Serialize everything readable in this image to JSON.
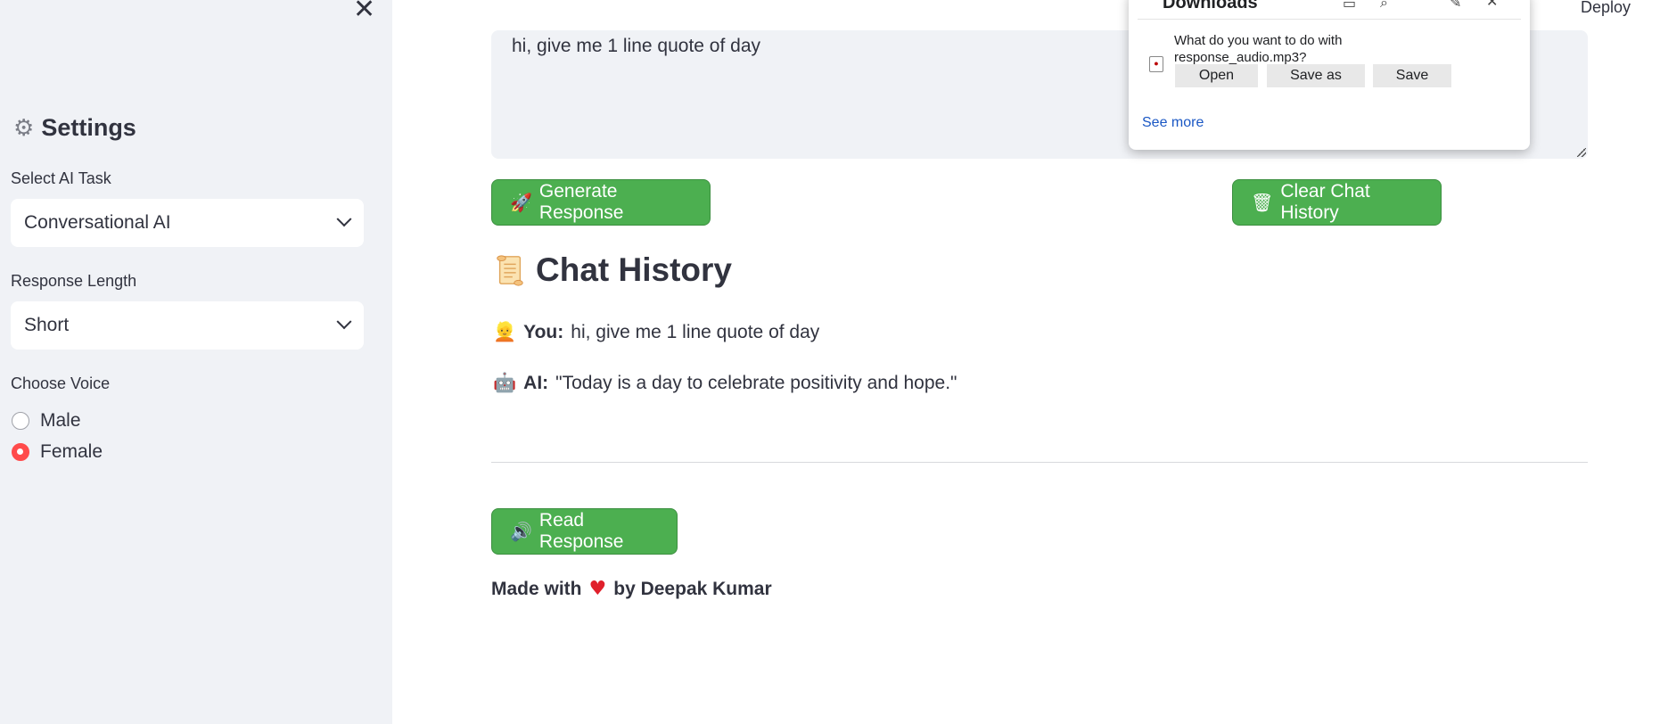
{
  "sidebar": {
    "close_glyph": "✕",
    "settings_icon": "gear-icon",
    "settings_title": "Settings",
    "task_label": "Select AI Task",
    "task_value": "Conversational AI",
    "length_label": "Response Length",
    "length_value": "Short",
    "voice_label": "Choose Voice",
    "voice_options": [
      {
        "label": "Male",
        "selected": false
      },
      {
        "label": "Female",
        "selected": true
      }
    ]
  },
  "main": {
    "prompt_text": "hi, give me 1 line quote of day",
    "generate_label": "Generate Response",
    "generate_icon": "🚀",
    "clear_label": "Clear Chat History",
    "clear_icon": "🗑",
    "chat_title": "Chat History",
    "chat": [
      {
        "speaker": "You:",
        "icon": "👱",
        "text": "hi, give me 1 line quote of day"
      },
      {
        "speaker": "AI:",
        "icon": "🤖",
        "text": "\"Today is a day to celebrate positivity and hope.\""
      }
    ],
    "read_label": "Read Response",
    "read_icon": "🔊",
    "footer_prefix": "Made with",
    "footer_heart": "♥",
    "footer_suffix": "by Deepak Kumar",
    "deploy_label": "Deploy"
  },
  "downloads": {
    "title": "Downloads",
    "question": "What do you want to do with response_audio.mp3?",
    "buttons": [
      "Open",
      "Save as",
      "Save"
    ],
    "see_more": "See more"
  },
  "colors": {
    "sidebar_bg": "#f0f2f6",
    "button_green": "#4caf50",
    "radio_accent": "#ff4b4b",
    "link_blue": "#1a57c4"
  }
}
